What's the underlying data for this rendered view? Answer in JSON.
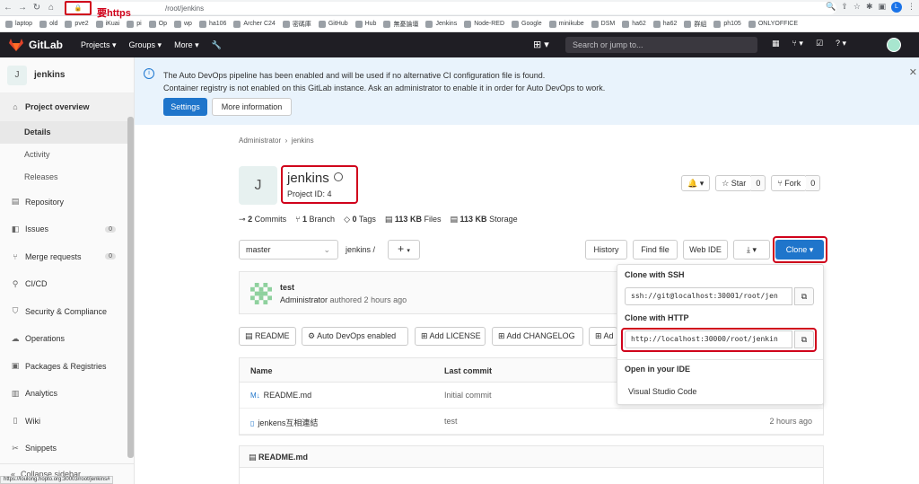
{
  "browser": {
    "annotation": "要https",
    "url": "/root/jenkins",
    "status_url": "https://loulong.hopto.org:30003/root/jenkins#",
    "profile": "L"
  },
  "bookmarks": [
    "laptop",
    "old",
    "pve2",
    "iKuai",
    "pi",
    "Op",
    "wp",
    "ha106",
    "Archer C24",
    "密碼庫",
    "GitHub",
    "Hub",
    "無憂論壇",
    "Jenkins",
    "Node-RED",
    "Google",
    "minikube",
    "DSM",
    "ha62",
    "ha62",
    "群組",
    "ph105",
    "ONLYOFFICE"
  ],
  "header": {
    "logo": "GitLab",
    "menu": [
      "Projects ▾",
      "Groups ▾",
      "More ▾"
    ],
    "search_placeholder": "Search or jump to..."
  },
  "sidebar": {
    "project_initial": "J",
    "project_name": "jenkins",
    "items": [
      {
        "label": "Project overview",
        "icon": "home-icon"
      },
      {
        "label": "Repository",
        "icon": "doc-icon"
      },
      {
        "label": "Issues",
        "icon": "issues-icon",
        "count": "0"
      },
      {
        "label": "Merge requests",
        "icon": "merge-icon",
        "count": "0"
      },
      {
        "label": "CI/CD",
        "icon": "rocket-icon"
      },
      {
        "label": "Security & Compliance",
        "icon": "shield-icon"
      },
      {
        "label": "Operations",
        "icon": "cloud-icon"
      },
      {
        "label": "Packages & Registries",
        "icon": "package-icon"
      },
      {
        "label": "Analytics",
        "icon": "chart-icon"
      },
      {
        "label": "Wiki",
        "icon": "book-icon"
      },
      {
        "label": "Snippets",
        "icon": "scissors-icon"
      }
    ],
    "sub_items": [
      "Details",
      "Activity",
      "Releases"
    ],
    "collapse": "Collapse sidebar"
  },
  "banner": {
    "line1": "The Auto DevOps pipeline has been enabled and will be used if no alternative CI configuration file is found.",
    "line2": "Container registry is not enabled on this GitLab instance. Ask an administrator to enable it in order for Auto DevOps to work.",
    "settings": "Settings",
    "more_info": "More information"
  },
  "breadcrumb": {
    "parent": "Administrator",
    "current": "jenkins"
  },
  "project": {
    "initial": "J",
    "title": "jenkins",
    "id_text": "Project ID: 4",
    "notif": "🔔 ▾",
    "star": "☆ Star",
    "star_count": "0",
    "fork": "⑂ Fork",
    "fork_count": "0"
  },
  "stats": {
    "commits_n": "2",
    "commits": "Commits",
    "branch_n": "1",
    "branch": "Branch",
    "tags_n": "0",
    "tags": "Tags",
    "files_n": "113 KB",
    "files": "Files",
    "storage_n": "113 KB",
    "storage": "Storage"
  },
  "toolbar": {
    "branch": "master",
    "path": "jenkins /",
    "history": "History",
    "find": "Find file",
    "webide": "Web IDE",
    "download": "⤓ ▾",
    "clone": "Clone ▾"
  },
  "commit": {
    "message": "test",
    "author": "Administrator",
    "rest": "authored 2 hours ago"
  },
  "pills": [
    "README",
    "Auto DevOps enabled",
    "Add LICENSE",
    "Add CHANGELOG",
    "Ad"
  ],
  "table": {
    "headers": [
      "Name",
      "Last commit",
      ""
    ],
    "rows": [
      {
        "name": "README.md",
        "commit": "Initial commit",
        "time": ""
      },
      {
        "name": "jenkens互相連結",
        "commit": "test",
        "time": "2 hours ago"
      }
    ]
  },
  "readme_title": "README.md",
  "clone_dropdown": {
    "ssh_label": "Clone with SSH",
    "ssh_url": "ssh://git@localhost:30001/root/jen",
    "http_label": "Clone with HTTP",
    "http_url": "http://localhost:30000/root/jenkin",
    "ide_label": "Open in your IDE",
    "ide_item": "Visual Studio Code"
  },
  "colors": {
    "brand": "#1f75cb",
    "highlight": "#d0021b",
    "header": "#1f1e24"
  }
}
